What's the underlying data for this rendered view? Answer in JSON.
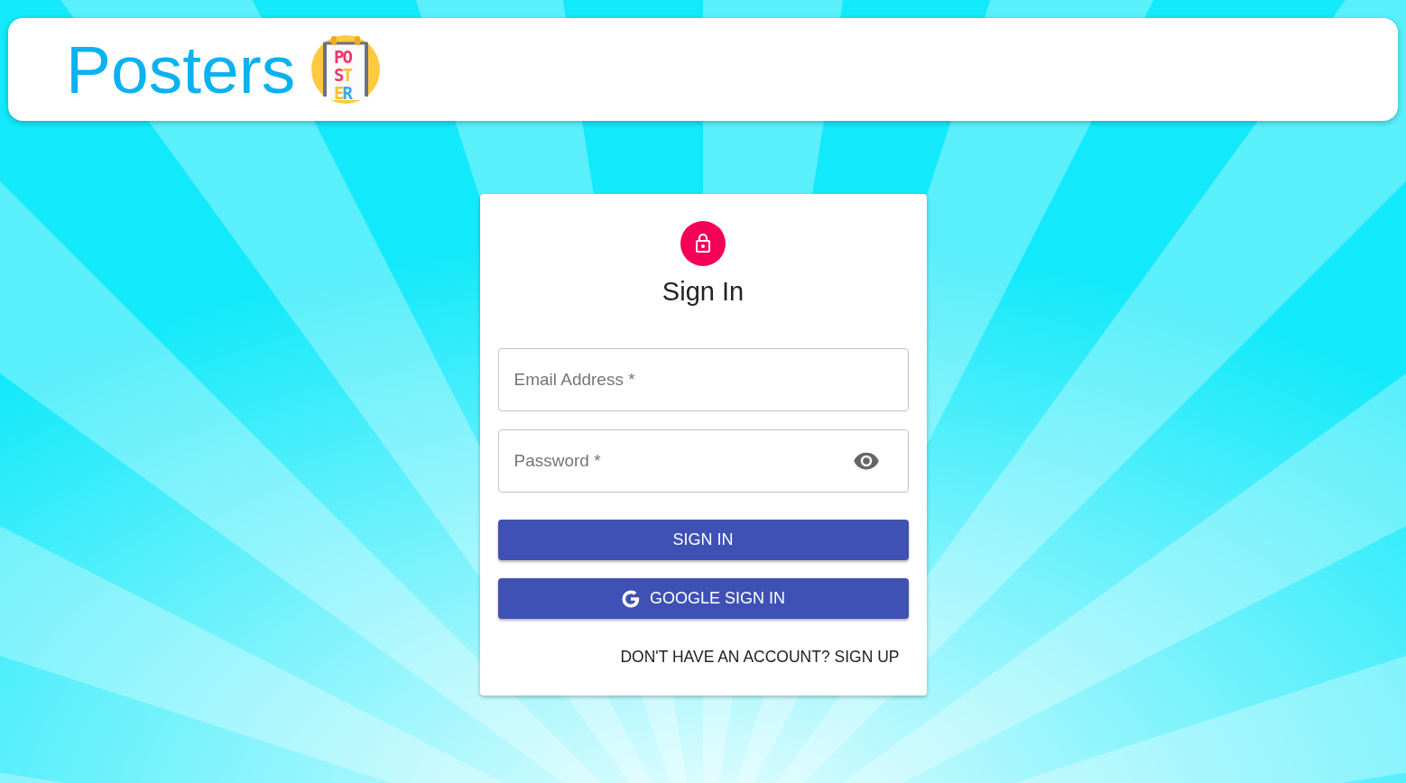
{
  "header": {
    "title": "Posters",
    "logo_lines": [
      "PO",
      "ST",
      "ER"
    ]
  },
  "sign_in": {
    "title": "Sign In",
    "fields": [
      {
        "kind": "text",
        "placeholder": "Email Address *"
      },
      {
        "kind": "password",
        "placeholder": "Password *"
      }
    ],
    "buttons": [
      {
        "kind": "primary",
        "label": "SIGN IN"
      },
      {
        "kind": "google",
        "label": "GOOGLE SIGN IN"
      }
    ],
    "signup_link": "DON'T HAVE AN ACCOUNT? SIGN UP"
  }
}
